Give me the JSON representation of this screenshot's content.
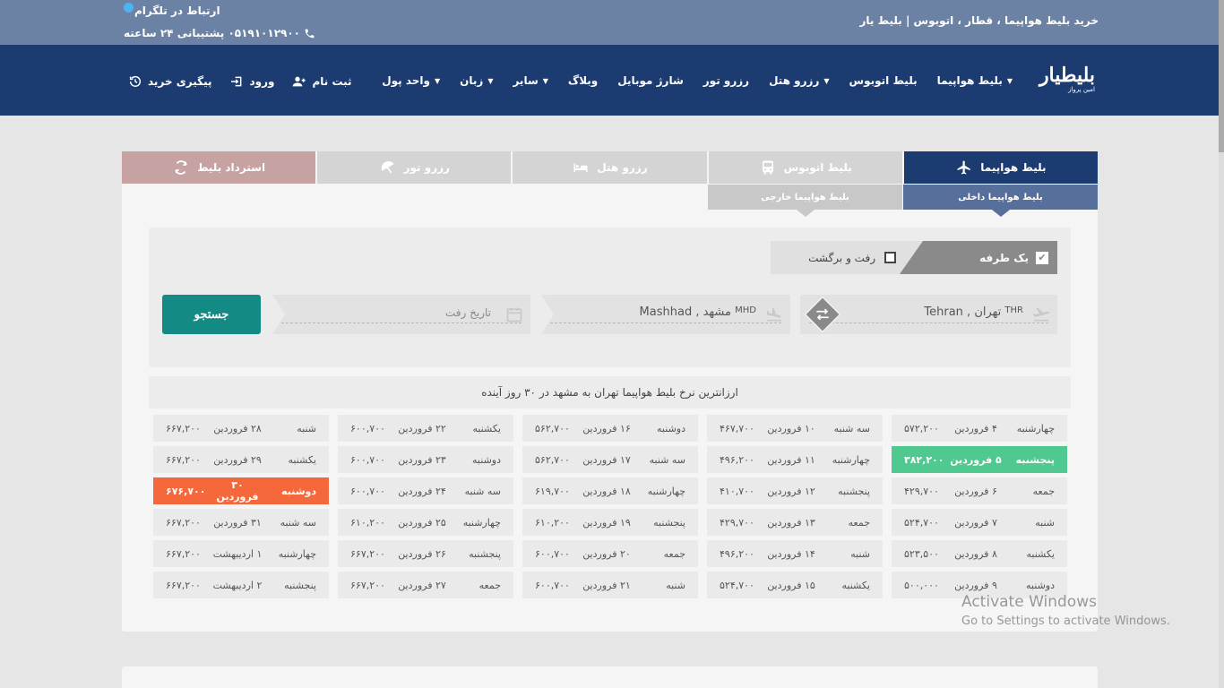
{
  "top": {
    "site_title": "خرید بلیط هواپیما ، قطار ، اتوبوس  |  بلیط یار",
    "telegram": "ارتباط در تلگرام",
    "phone": "۰۵۱۹۱۰۱۲۹۰۰ پشتیبانی ۲۴ ساعته"
  },
  "logo": {
    "main": "بلیطیار",
    "sub": "امین پرواز"
  },
  "nav": {
    "items": [
      {
        "label": "بلیط هواپیما",
        "caret": true
      },
      {
        "label": "بلیط اتوبوس",
        "caret": false
      },
      {
        "label": "رزرو هتل",
        "caret": true
      },
      {
        "label": "رزرو تور",
        "caret": false
      },
      {
        "label": "شارژ موبایل",
        "caret": false
      },
      {
        "label": "وبلاگ",
        "caret": false
      },
      {
        "label": "سایر",
        "caret": true
      },
      {
        "label": "زبان",
        "caret": true
      },
      {
        "label": "واحد پول",
        "caret": true
      }
    ],
    "register": "ثبت نام",
    "login": "ورود",
    "track": "پیگیری خرید"
  },
  "tabs": {
    "flight": "بلیط هواپیما",
    "bus": "بلیط اتوبوس",
    "hotel": "رزرو هتل",
    "tour": "رزرو تور",
    "refund": "استرداد بلیط"
  },
  "subtabs": {
    "domestic": "بلیط هواپیما داخلی",
    "foreign": "بلیط هواپیما خارجی"
  },
  "search": {
    "oneway": "یک طرفه",
    "roundtrip": "رفت و برگشت",
    "origin": "Tehran , تهران",
    "origin_code": "THR",
    "destination": "Mashhad , مشهد",
    "destination_code": "MHD",
    "date_placeholder": "تاریخ رفت",
    "button": "جستجو"
  },
  "cheapest_title": "ارزانترین نرخ بلیط هواپیما تهران به مشهد در ۳۰ روز آینده",
  "colors": {
    "cheapest": "#4fc98f",
    "expensive": "#f4683c"
  },
  "fares": [
    [
      {
        "weekday": "چهارشنبه",
        "date": "۴ فروردین",
        "price": "۵۷۲,۲۰۰"
      },
      {
        "weekday": "پنجشنبه",
        "date": "۵ فروردین",
        "price": "۳۸۲,۲۰۰",
        "flag": "cheapest"
      },
      {
        "weekday": "جمعه",
        "date": "۶ فروردین",
        "price": "۴۲۹,۷۰۰"
      },
      {
        "weekday": "شنبه",
        "date": "۷ فروردین",
        "price": "۵۲۴,۷۰۰"
      },
      {
        "weekday": "یکشنبه",
        "date": "۸ فروردین",
        "price": "۵۲۳,۵۰۰"
      },
      {
        "weekday": "دوشنبه",
        "date": "۹ فروردین",
        "price": "۵۰۰,۰۰۰"
      }
    ],
    [
      {
        "weekday": "سه شنبه",
        "date": "۱۰ فروردین",
        "price": "۴۶۷,۷۰۰"
      },
      {
        "weekday": "چهارشنبه",
        "date": "۱۱ فروردین",
        "price": "۴۹۶,۲۰۰"
      },
      {
        "weekday": "پنجشنبه",
        "date": "۱۲ فروردین",
        "price": "۴۱۰,۷۰۰"
      },
      {
        "weekday": "جمعه",
        "date": "۱۳ فروردین",
        "price": "۴۲۹,۷۰۰"
      },
      {
        "weekday": "شنبه",
        "date": "۱۴ فروردین",
        "price": "۴۹۶,۲۰۰"
      },
      {
        "weekday": "یکشنبه",
        "date": "۱۵ فروردین",
        "price": "۵۲۴,۷۰۰"
      }
    ],
    [
      {
        "weekday": "دوشنبه",
        "date": "۱۶ فروردین",
        "price": "۵۶۲,۷۰۰"
      },
      {
        "weekday": "سه شنبه",
        "date": "۱۷ فروردین",
        "price": "۵۶۲,۷۰۰"
      },
      {
        "weekday": "چهارشنبه",
        "date": "۱۸ فروردین",
        "price": "۶۱۹,۷۰۰"
      },
      {
        "weekday": "پنجشنبه",
        "date": "۱۹ فروردین",
        "price": "۶۱۰,۲۰۰"
      },
      {
        "weekday": "جمعه",
        "date": "۲۰ فروردین",
        "price": "۶۰۰,۷۰۰"
      },
      {
        "weekday": "شنبه",
        "date": "۲۱ فروردین",
        "price": "۶۰۰,۷۰۰"
      }
    ],
    [
      {
        "weekday": "یکشنبه",
        "date": "۲۲ فروردین",
        "price": "۶۰۰,۷۰۰"
      },
      {
        "weekday": "دوشنبه",
        "date": "۲۳ فروردین",
        "price": "۶۰۰,۷۰۰"
      },
      {
        "weekday": "سه شنبه",
        "date": "۲۴ فروردین",
        "price": "۶۰۰,۷۰۰"
      },
      {
        "weekday": "چهارشنبه",
        "date": "۲۵ فروردین",
        "price": "۶۱۰,۲۰۰"
      },
      {
        "weekday": "پنجشنبه",
        "date": "۲۶ فروردین",
        "price": "۶۶۷,۲۰۰"
      },
      {
        "weekday": "جمعه",
        "date": "۲۷ فروردین",
        "price": "۶۶۷,۲۰۰"
      }
    ],
    [
      {
        "weekday": "شنبه",
        "date": "۲۸ فروردین",
        "price": "۶۶۷,۲۰۰"
      },
      {
        "weekday": "یکشنبه",
        "date": "۲۹ فروردین",
        "price": "۶۶۷,۲۰۰"
      },
      {
        "weekday": "دوشنبه",
        "date": "۳۰ فروردین",
        "price": "۶۷۶,۷۰۰",
        "flag": "expensive"
      },
      {
        "weekday": "سه شنبه",
        "date": "۳۱ فروردین",
        "price": "۶۶۷,۲۰۰"
      },
      {
        "weekday": "چهارشنبه",
        "date": "۱ اردیبهشت",
        "price": "۶۶۷,۲۰۰"
      },
      {
        "weekday": "پنجشنبه",
        "date": "۲ اردیبهشت",
        "price": "۶۶۷,۲۰۰"
      }
    ]
  ],
  "watermark": {
    "line1": "Activate Windows",
    "line2": "Go to Settings to activate Windows."
  }
}
